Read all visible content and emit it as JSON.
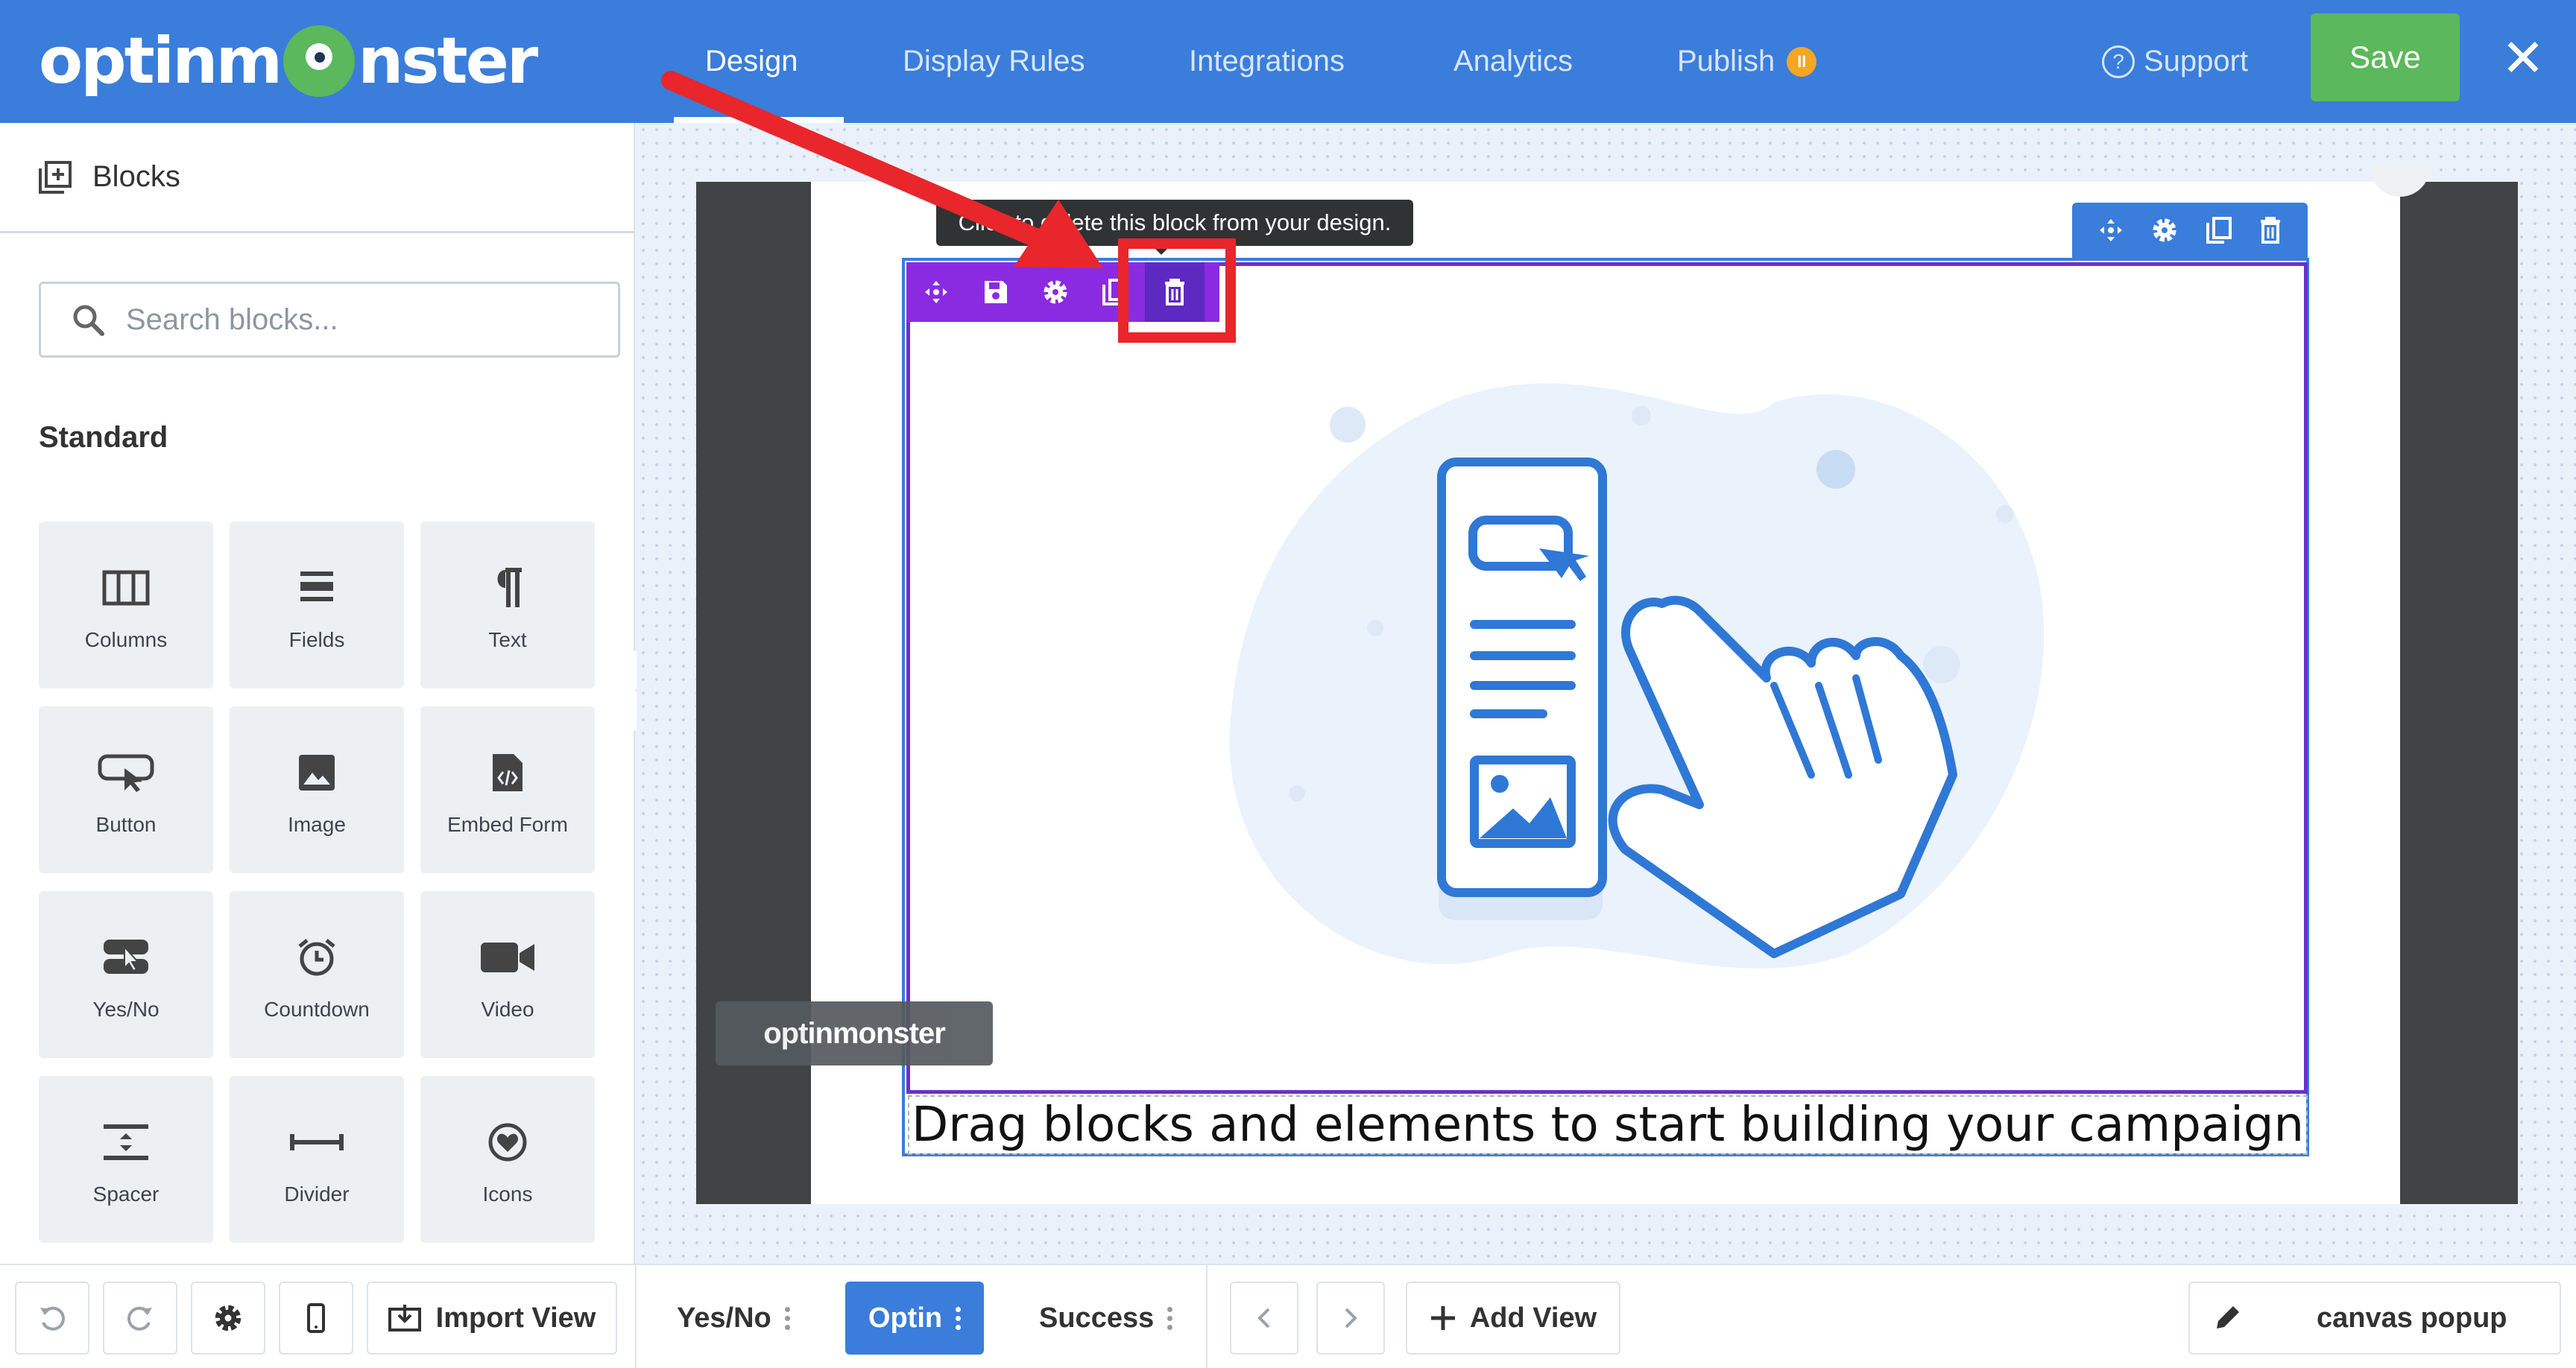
{
  "app": {
    "logo_text_left": "optinm",
    "logo_text_right": "nster"
  },
  "nav": {
    "tabs": [
      {
        "label": "Design"
      },
      {
        "label": "Display Rules"
      },
      {
        "label": "Integrations"
      },
      {
        "label": "Analytics"
      },
      {
        "label": "Publish",
        "badge": "II"
      }
    ],
    "support_label": "Support",
    "save_label": "Save",
    "close_glyph": "✕"
  },
  "sidebar": {
    "title": "Blocks",
    "search_placeholder": "Search blocks...",
    "section_title": "Standard",
    "blocks": [
      {
        "label": "Columns",
        "icon": "columns-icon"
      },
      {
        "label": "Fields",
        "icon": "fields-icon"
      },
      {
        "label": "Text",
        "icon": "paragraph-icon"
      },
      {
        "label": "Button",
        "icon": "button-cursor-icon"
      },
      {
        "label": "Image",
        "icon": "image-icon"
      },
      {
        "label": "Embed Form",
        "icon": "embed-code-icon"
      },
      {
        "label": "Yes/No",
        "icon": "yes-no-icon"
      },
      {
        "label": "Countdown",
        "icon": "alarm-clock-icon"
      },
      {
        "label": "Video",
        "icon": "video-camera-icon"
      },
      {
        "label": "Spacer",
        "icon": "spacer-icon"
      },
      {
        "label": "Divider",
        "icon": "divider-icon"
      },
      {
        "label": "Icons",
        "icon": "heart-circle-icon"
      }
    ]
  },
  "canvas": {
    "tooltip": "Click to delete this block from your design.",
    "caption": "Drag blocks and elements to start building your campaign",
    "watermark": "optinmonster"
  },
  "bottom": {
    "import_view_label": "Import View",
    "views": [
      {
        "label": "Yes/No"
      },
      {
        "label": "Optin"
      },
      {
        "label": "Success"
      }
    ],
    "add_view_label": "Add View",
    "canvas_label": "canvas popup"
  },
  "colors": {
    "topbar": "#3a7ddb",
    "save": "#5cb85c",
    "column_toolbar": "#8a2be2",
    "highlight_red": "#e8262b",
    "badge": "#f5a623"
  }
}
